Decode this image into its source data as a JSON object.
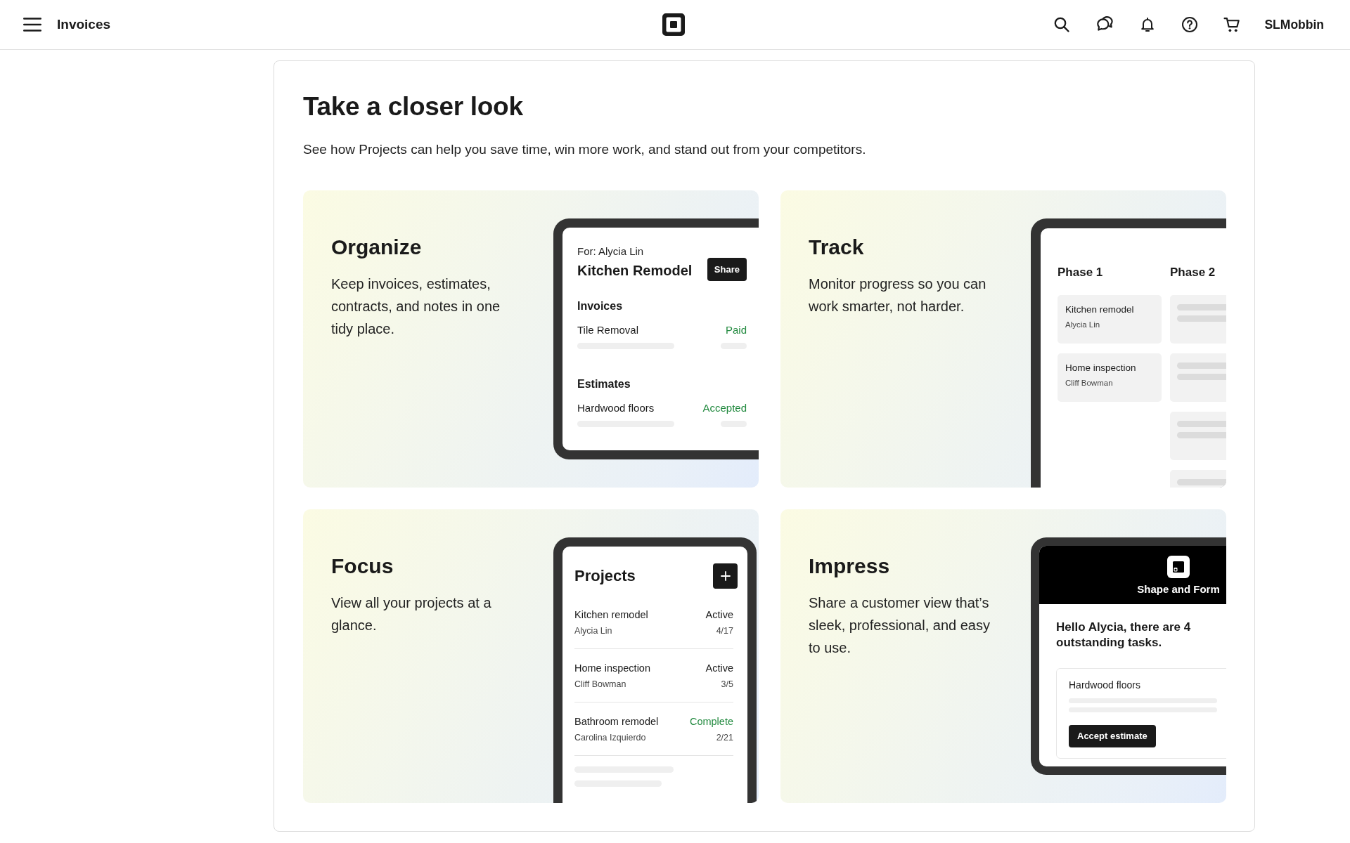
{
  "top_bar": {
    "title": "Invoices",
    "account": "SLMobbin"
  },
  "intro": {
    "heading": "Take a closer look",
    "text": "See how Projects can help you save time, win more work, and stand out from your competitors."
  },
  "cards": [
    {
      "title": "Organize",
      "description": "Keep invoices, estimates, contracts, and notes in one tidy place.",
      "mockup": {
        "kind": "detail",
        "client": "For: Alycia Lin",
        "title": "Kitchen Remodel",
        "button": "Share",
        "sections": [
          {
            "heading": "Invoices",
            "items": [
              {
                "name": "Tile Removal",
                "status": "Paid"
              }
            ]
          },
          {
            "heading": "Estimates",
            "items": [
              {
                "name": "Hardwood floors",
                "status": "Accepted"
              }
            ]
          }
        ]
      }
    },
    {
      "title": "Track",
      "description": "Monitor progress so you can work smarter, not harder.",
      "mockup": {
        "kind": "board",
        "columns": [
          {
            "title": "Phase 1",
            "tasks": [
              {
                "name": "Kitchen remodel",
                "client": "Alycia Lin"
              },
              {
                "name": "Home inspection",
                "client": "Cliff Bowman"
              }
            ]
          },
          {
            "title": "Phase 2"
          }
        ]
      }
    },
    {
      "title": "Focus",
      "description": "View all your projects at a glance.",
      "mockup": {
        "kind": "list",
        "title": "Projects",
        "projects": [
          {
            "name": "Kitchen remodel",
            "client": "Alycia Lin",
            "status": "Active",
            "count": "4/17",
            "color": "#1a1a1a"
          },
          {
            "name": "Home inspection",
            "client": "Cliff Bowman",
            "status": "Active",
            "count": "3/5",
            "color": "#1a1a1a"
          },
          {
            "name": "Bathroom remodel",
            "client": "Carolina Izquierdo",
            "status": "Complete",
            "count": "2/21",
            "color": "#228a3f"
          }
        ]
      }
    },
    {
      "title": "Impress",
      "description": "Share a customer view that’s sleek, professional, and easy to use.",
      "mockup": {
        "kind": "portal",
        "business": "Shape and Form",
        "greeting": "Hello Alycia, there are 4 outstanding tasks.",
        "task": {
          "name": "Hardwood floors",
          "button": "Accept estimate"
        }
      }
    }
  ]
}
